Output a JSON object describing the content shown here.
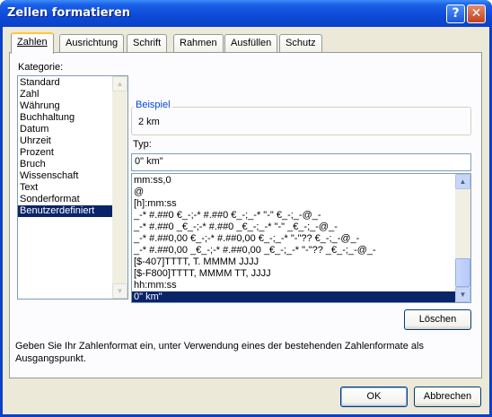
{
  "window": {
    "title": "Zellen formatieren",
    "help_label": "?",
    "close_label": "✕"
  },
  "tabs": [
    {
      "label": "Zahlen",
      "active": true
    },
    {
      "label": "Ausrichtung",
      "active": false
    },
    {
      "label": "Schrift",
      "active": false
    },
    {
      "label": "Rahmen",
      "active": false
    },
    {
      "label": "Ausfüllen",
      "active": false
    },
    {
      "label": "Schutz",
      "active": false
    }
  ],
  "kategorie": {
    "label": "Kategorie:",
    "items": [
      "Standard",
      "Zahl",
      "Währung",
      "Buchhaltung",
      "Datum",
      "Uhrzeit",
      "Prozent",
      "Bruch",
      "Wissenschaft",
      "Text",
      "Sonderformat",
      "Benutzerdefiniert"
    ],
    "selected_index": 11
  },
  "beispiel": {
    "label": "Beispiel",
    "value": "2 km"
  },
  "typ": {
    "label": "Typ:",
    "value": "0\" km\"",
    "list": [
      "mm:ss,0",
      "@",
      "[h]:mm:ss",
      "_-* #.##0 €_-;-* #.##0 €_-;_-* \"-\" €_-;_-@_-",
      "_-* #.##0 _€_-;-* #.##0 _€_-;_-* \"-\" _€_-;_-@_-",
      "_-* #.##0,00 €_-;-* #.##0,00 €_-;_-* \"-\"?? €_-;_-@_-",
      "_-* #.##0,00 _€_-;-* #.##0,00 _€_-;_-* \"-\"?? _€_-;_-@_-",
      "[$-407]TTTT, T. MMMM JJJJ",
      "[$-F800]TTTT, MMMM TT, JJJJ",
      "hh:mm:ss",
      "0\" km\""
    ],
    "selected_index": 10
  },
  "loeschen_label": "Löschen",
  "hint": "Geben Sie Ihr Zahlenformat ein, unter Verwendung eines der bestehenden Zahlenformate als Ausgangspunkt.",
  "ok_label": "OK",
  "cancel_label": "Abbrechen",
  "colors": {
    "titlebar": "#0a41c8",
    "dialog_bg": "#ece9d8",
    "selection": "#0a246a",
    "group_title": "#0046d5",
    "active_tab_accent": "#ffc83c"
  }
}
